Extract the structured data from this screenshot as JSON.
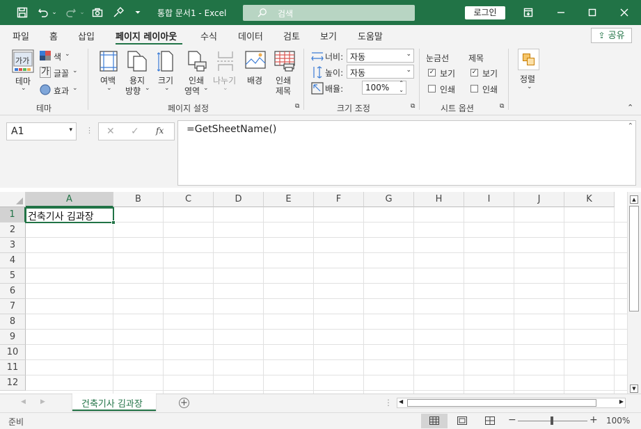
{
  "titlebar": {
    "doc_title": "통합 문서1  -  Excel",
    "search_placeholder": "검색",
    "login_label": "로그인"
  },
  "tabs": [
    "파일",
    "홈",
    "삽입",
    "페이지 레이아웃",
    "수식",
    "데이터",
    "검토",
    "보기",
    "도움말"
  ],
  "active_tab": "페이지 레이아웃",
  "share_label": "공유",
  "ribbon": {
    "theme": {
      "themes_label": "테마",
      "colors_label": "색",
      "fonts_label": "글꼴",
      "effects_label": "효과",
      "group_label": "테마"
    },
    "page_setup": {
      "margins_label": "여백",
      "orientation_line1": "용지",
      "orientation_line2": "방향",
      "size_label": "크기",
      "print_area_line1": "인쇄",
      "print_area_line2": "영역",
      "breaks_label": "나누기",
      "background_label": "배경",
      "print_titles_line1": "인쇄",
      "print_titles_line2": "제목",
      "group_label": "페이지 설정"
    },
    "scale": {
      "width_label": "너비:",
      "width_value": "자동",
      "height_label": "높이:",
      "height_value": "자동",
      "scale_label": "배율:",
      "scale_value": "100%",
      "group_label": "크기 조정"
    },
    "sheet_options": {
      "gridlines_label": "눈금선",
      "headings_label": "제목",
      "view_label": "보기",
      "print_label": "인쇄",
      "gridlines_view": true,
      "gridlines_print": false,
      "headings_view": true,
      "headings_print": false,
      "group_label": "시트 옵션"
    },
    "arrange": {
      "arrange_label": "정렬"
    }
  },
  "formula_bar": {
    "name_box": "A1",
    "formula": "=GetSheetName()"
  },
  "grid": {
    "columns": [
      "A",
      "B",
      "C",
      "D",
      "E",
      "F",
      "G",
      "H",
      "I",
      "J",
      "K"
    ],
    "rows": [
      "1",
      "2",
      "3",
      "4",
      "5",
      "6",
      "7",
      "8",
      "9",
      "10",
      "11",
      "12"
    ],
    "cell_A1": "건축기사 김과장"
  },
  "sheet_tabs": [
    "건축기사 김과장"
  ],
  "status": {
    "ready_label": "준비",
    "zoom_label": "100%"
  },
  "colors": {
    "accent": "#217346",
    "titlebar_bg": "#217346",
    "ribbon_bg": "#f3f3f3"
  }
}
